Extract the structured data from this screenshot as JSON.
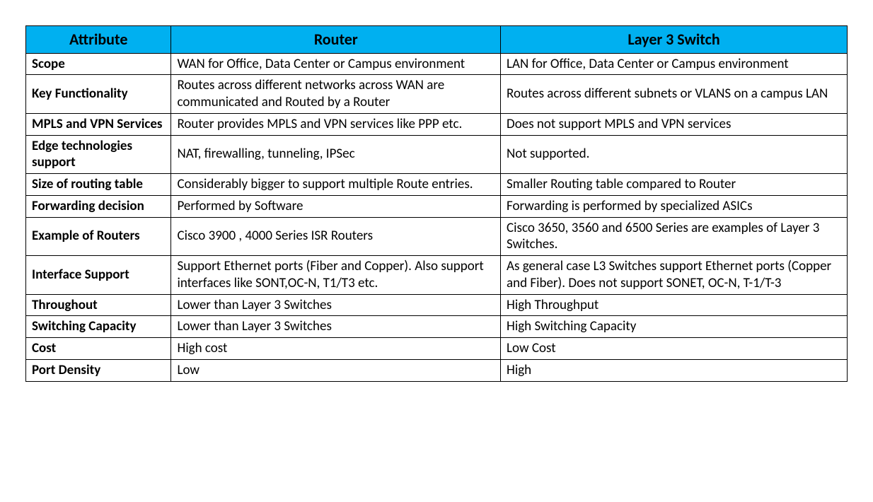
{
  "headers": {
    "attribute": "Attribute",
    "router": "Router",
    "switch": "Layer 3 Switch"
  },
  "rows": [
    {
      "attribute": "Scope",
      "router": "WAN for Office, Data Center  or Campus environment",
      "switch": "LAN for Office, Data Center or Campus environment"
    },
    {
      "attribute": "Key Functionality",
      "router": "Routes across different networks across WAN are communicated and Routed by a Router",
      "switch": "Routes across different subnets or VLANS on a campus LAN"
    },
    {
      "attribute": "MPLS and VPN Services",
      "router": "Router provides MPLS and VPN services like PPP etc.",
      "switch": "Does not support MPLS and VPN services"
    },
    {
      "attribute": "Edge technologies support",
      "router": "NAT, firewalling, tunneling, IPSec",
      "switch": "Not supported."
    },
    {
      "attribute": "Size of routing table",
      "router": "Considerably bigger to support multiple Route entries.",
      "switch": "Smaller Routing table compared to Router"
    },
    {
      "attribute": "Forwarding decision",
      "router": "Performed by Software",
      "switch": "Forwarding is performed by specialized ASICs"
    },
    {
      "attribute": "Example of Routers",
      "router": "Cisco 3900 , 4000 Series ISR Routers",
      "switch": "Cisco 3650, 3560 and 6500 Series are examples of Layer 3 Switches."
    },
    {
      "attribute": "Interface Support",
      "router": "Support Ethernet ports (Fiber and Copper). Also support interfaces like SONT,OC-N, T1/T3 etc.",
      "switch": "As general case L3 Switches support Ethernet ports (Copper and Fiber). Does not support SONET, OC-N, T-1/T-3"
    },
    {
      "attribute": "Throughout",
      "router": "Lower than Layer 3 Switches",
      "switch": "High Throughput"
    },
    {
      "attribute": "Switching Capacity",
      "router": "Lower than Layer 3 Switches",
      "switch": "High Switching Capacity"
    },
    {
      "attribute": "Cost",
      "router": "High cost",
      "switch": "Low Cost"
    },
    {
      "attribute": "Port Density",
      "router": "Low",
      "switch": "High"
    }
  ]
}
